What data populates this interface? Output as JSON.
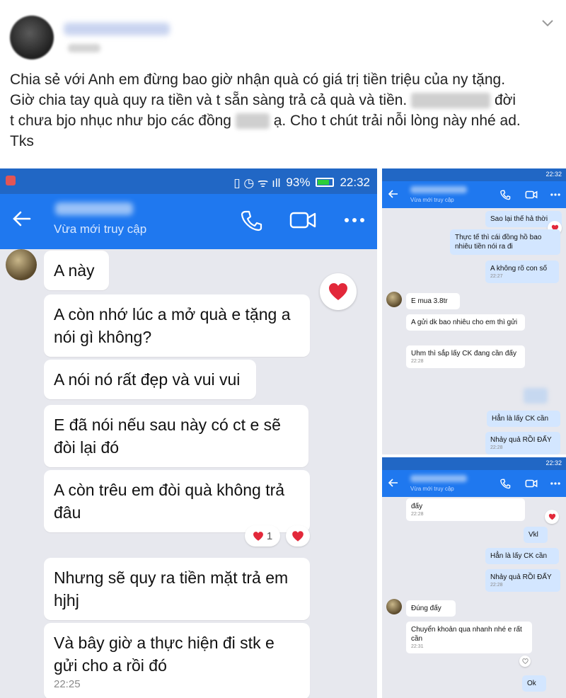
{
  "post": {
    "text_lines": [
      "Chia sẻ với Anh em đừng bao giờ nhận quà có giá trị tiền triệu của ny tặng.",
      "Giờ chia tay quà quy ra tiền và t sẵn sàng trả cả quà và tiền.",
      "đời",
      "t chưa bjo nhục như bjo các đồng",
      "ạ. Cho t chút trải nỗi lòng này nhé ad.",
      "Tks"
    ]
  },
  "chat_left": {
    "status": {
      "battery": "93%",
      "time": "22:32"
    },
    "subtitle": "Vừa mới truy cập",
    "messages": [
      "A này",
      "A còn nhớ lúc a mở quà e tặng a nói gì không?",
      "A nói nó rất đẹp và vui vui",
      "E đã nói nếu sau này có ct e sẽ đòi lại đó",
      "A còn trêu em đòi quà không trả đâu",
      "Nhưng sẽ quy ra tiền mặt trả em hjhj",
      "Và bây giờ a thực hiện đi stk e gửi cho a rồi đó"
    ],
    "last_time": "22:25",
    "reaction_count": "1"
  },
  "chat_r1": {
    "status": "22:32",
    "subtitle": "Vừa mới truy cập",
    "out_1": "Sao lại thế hả thời",
    "out_2": "Thực tế thì cái đồng hồ bao nhiêu tiền nói ra đi",
    "out_3": "A không rõ con số",
    "out_3_time": "22:27",
    "in_1": "E mua 3.8tr",
    "in_2": "A gửi dk bao nhiêu cho em thì gửi",
    "in_3": "Uhm thì sắp lấy CK đang cần đấy",
    "in_3_time": "22:28",
    "out_4": "Hẳn là lấy CK cần",
    "out_5": "Nhảy quả RỒI ĐẤY",
    "out_5_time": "22:28"
  },
  "chat_r2": {
    "status": "22:32",
    "subtitle": "Vừa mới truy cập",
    "in_top": "đấy",
    "in_top_time": "22:28",
    "out_1": "Vkl",
    "out_2": "Hẳn là lấy CK cần",
    "out_3": "Nhảy quả RỒI ĐẤY",
    "out_3_time": "22:28",
    "in_1": "Đúng đấy",
    "in_2": "Chuyển khoản qua nhanh nhé e rất cần",
    "in_2_time": "22:31",
    "out_4": "Ok"
  },
  "colors": {
    "status_blue": "#2167c5",
    "appbar_blue": "#1f78ef",
    "chat_bg": "#e7e8ee",
    "heart": "#e2283a"
  }
}
